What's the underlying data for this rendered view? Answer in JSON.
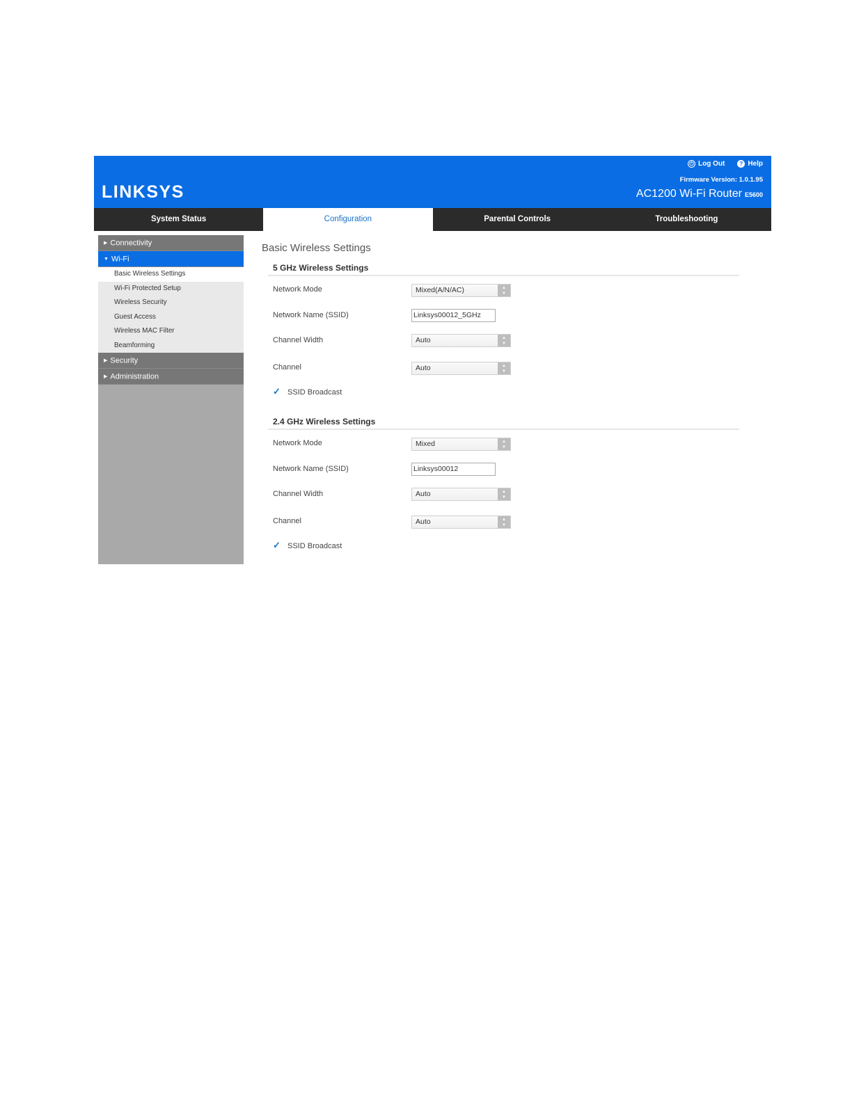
{
  "header": {
    "logo": "LINKSYS",
    "logout_label": "Log Out",
    "help_label": "Help",
    "firmware": "Firmware Version: 1.0.1.95",
    "router_name": "AC1200 Wi-Fi Router",
    "router_model": "E5600"
  },
  "nav": {
    "tabs": [
      {
        "label": "System Status"
      },
      {
        "label": "Configuration"
      },
      {
        "label": "Parental Controls"
      },
      {
        "label": "Troubleshooting"
      }
    ],
    "active": "Configuration"
  },
  "sidebar": {
    "groups": [
      {
        "label": "Connectivity"
      },
      {
        "label": "Wi-Fi"
      },
      {
        "label": "Security"
      },
      {
        "label": "Administration"
      }
    ],
    "wifi_items": [
      {
        "label": "Basic Wireless Settings"
      },
      {
        "label": "Wi-Fi Protected Setup"
      },
      {
        "label": "Wireless Security"
      },
      {
        "label": "Guest Access"
      },
      {
        "label": "Wireless MAC Filter"
      },
      {
        "label": "Beamforming"
      }
    ]
  },
  "main": {
    "title": "Basic Wireless Settings",
    "sections": [
      {
        "title": "5 GHz Wireless Settings",
        "network_mode_label": "Network Mode",
        "network_mode_value": "Mixed(A/N/AC)",
        "ssid_label": "Network Name (SSID)",
        "ssid_value": "Linksys00012_5GHz",
        "channel_width_label": "Channel Width",
        "channel_width_value": "Auto",
        "channel_label": "Channel",
        "channel_value": "Auto",
        "broadcast_label": "SSID Broadcast"
      },
      {
        "title": "2.4 GHz Wireless Settings",
        "network_mode_label": "Network Mode",
        "network_mode_value": "Mixed",
        "ssid_label": "Network Name (SSID)",
        "ssid_value": "Linksys00012",
        "channel_width_label": "Channel Width",
        "channel_width_value": "Auto",
        "channel_label": "Channel",
        "channel_value": "Auto",
        "broadcast_label": "SSID Broadcast"
      }
    ]
  },
  "colors": {
    "brand_blue": "#0b6de3",
    "nav_dark": "#2b2b2b",
    "sidebar_gray": "#a9a9a9"
  }
}
